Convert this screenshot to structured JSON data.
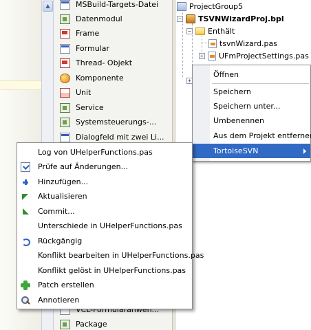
{
  "palette": {
    "items": [
      {
        "label": "MSBuild-Targets-Datei",
        "icon": "msbuild-icon"
      },
      {
        "label": "Datenmodul",
        "icon": "datamodule-icon"
      },
      {
        "label": "Frame",
        "icon": "frame-icon"
      },
      {
        "label": "Formular",
        "icon": "form-icon"
      },
      {
        "label": "Thread- Objekt",
        "icon": "thread-icon"
      },
      {
        "label": "Komponente",
        "icon": "component-icon"
      },
      {
        "label": "Unit",
        "icon": "unit-icon"
      },
      {
        "label": "Service",
        "icon": "service-icon"
      },
      {
        "label": "Systemsteuerungs-...",
        "icon": "control-panel-icon"
      },
      {
        "label": "Dialogfeld mit zwei Li...",
        "icon": "dialog-icon"
      }
    ],
    "bottom_items": [
      {
        "label": "VCL-Formularanwen...",
        "icon": "vcl-form-icon"
      },
      {
        "label": "Package",
        "icon": "package-icon"
      }
    ]
  },
  "tree": {
    "group": "ProjectGroup5",
    "project": "TSVNWizardProj.bpl",
    "folder": "Enthält",
    "files": [
      "tsvnWizard.pas",
      "UFmProjectSettings.pas"
    ]
  },
  "context_menu": {
    "items": [
      "Öffnen",
      "Speichern",
      "Speichern unter...",
      "Umbenennen",
      "Aus dem Projekt entfernen",
      "TortoiseSVN"
    ]
  },
  "submenu": {
    "items": [
      {
        "label": "Log von UHelperFunctions.pas",
        "icon": ""
      },
      {
        "label": "Prüfe auf Änderungen...",
        "icon": "check-changes-icon"
      },
      {
        "label": "Hinzufügen...",
        "icon": "add-icon"
      },
      {
        "label": "Aktualisieren",
        "icon": "update-icon"
      },
      {
        "label": "Commit...",
        "icon": "commit-icon"
      },
      {
        "label": "Unterschiede in UHelperFunctions.pas",
        "icon": ""
      },
      {
        "label": "Rückgängig",
        "icon": "revert-icon"
      },
      {
        "label": "Konflikt bearbeiten in UHelperFunctions.pas",
        "icon": ""
      },
      {
        "label": "Konflikt gelöst in UHelperFunctions.pas",
        "icon": ""
      },
      {
        "label": "Patch erstellen",
        "icon": "patch-icon"
      },
      {
        "label": "Annotieren",
        "icon": "annotate-icon"
      }
    ]
  },
  "colors": {
    "selection": "#316ac5",
    "menu_border": "#8c8c8c"
  }
}
